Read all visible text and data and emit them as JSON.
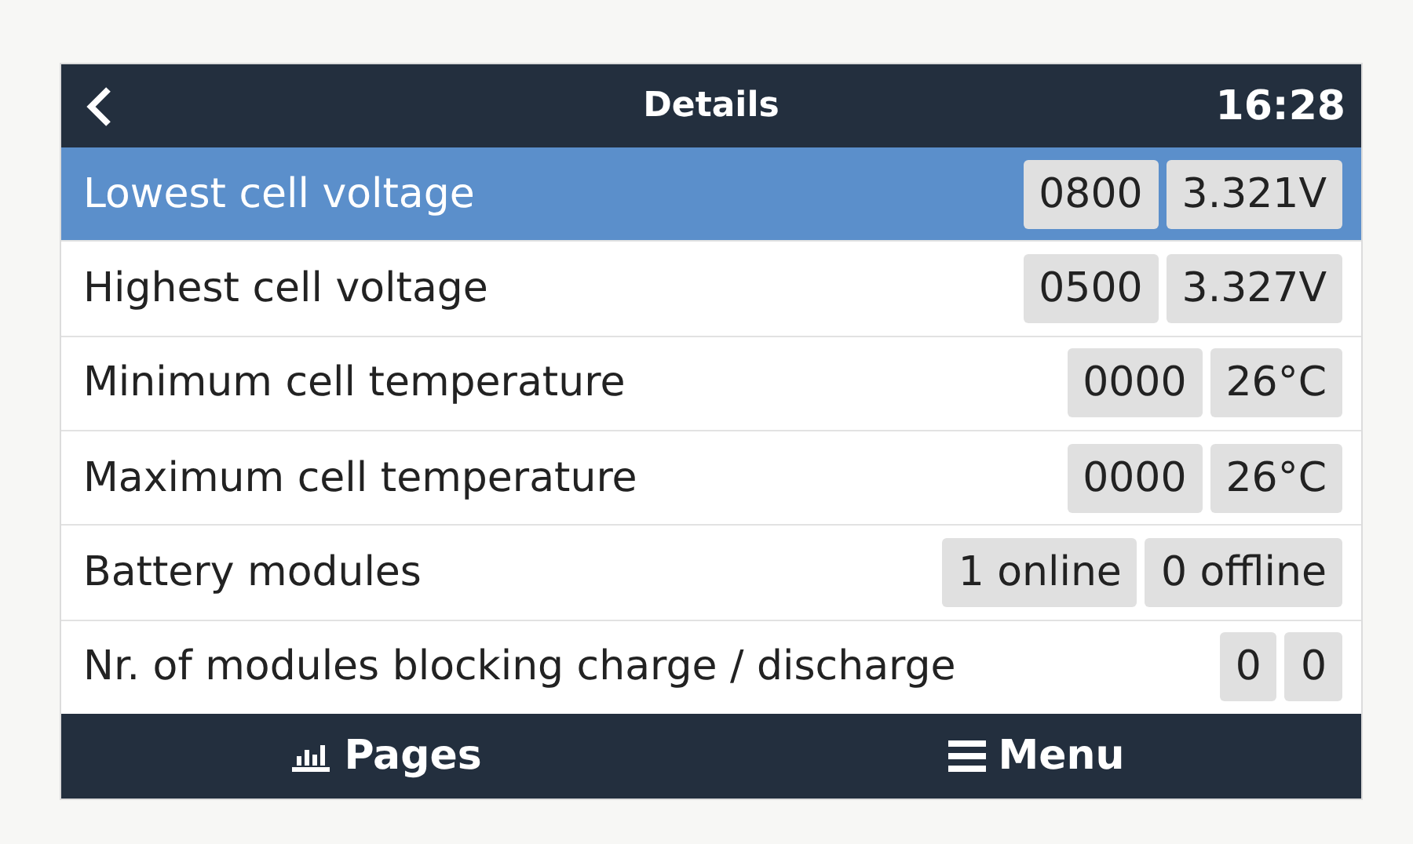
{
  "header": {
    "title": "Details",
    "time": "16:28"
  },
  "rows": [
    {
      "label": "Lowest cell voltage",
      "selected": true,
      "values": [
        "0800",
        "3.321V"
      ]
    },
    {
      "label": "Highest cell voltage",
      "selected": false,
      "values": [
        "0500",
        "3.327V"
      ]
    },
    {
      "label": "Minimum cell temperature",
      "selected": false,
      "values": [
        "0000",
        "26°C"
      ]
    },
    {
      "label": "Maximum cell temperature",
      "selected": false,
      "values": [
        "0000",
        "26°C"
      ]
    },
    {
      "label": "Battery modules",
      "selected": false,
      "values": [
        "1 online",
        "0 offline"
      ]
    },
    {
      "label": "Nr. of modules blocking charge / discharge",
      "selected": false,
      "values": [
        "0",
        "0"
      ]
    }
  ],
  "footer": {
    "pages": "Pages",
    "menu": "Menu"
  }
}
